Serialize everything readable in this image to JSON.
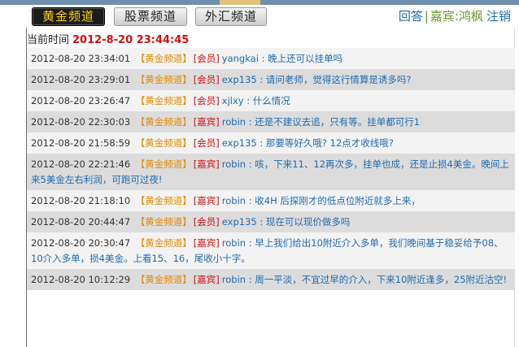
{
  "header": {
    "tabs": [
      {
        "label": "黄金频道",
        "active": true
      },
      {
        "label": "股票频道",
        "active": false
      },
      {
        "label": "外汇频道",
        "active": false
      }
    ],
    "reply_label": "回答",
    "separator": "|",
    "guest_label": "嘉宾:",
    "username": "鸿枫",
    "logout_label": "注销"
  },
  "current_time": {
    "label": "当前时间",
    "value": "2012-8-20 23:44:45"
  },
  "messages": [
    {
      "time": "2012-08-20 23:34:01",
      "channel": "【黄金频道】",
      "role": "[会员]",
      "user": "yangkai",
      "text": " : 晚上还可以挂单吗"
    },
    {
      "time": "2012-08-20 23:29:01",
      "channel": "【黄金频道】",
      "role": "[会员]",
      "user": "exp135",
      "text": " : 请问老师，觉得这行情算是诱多吗?"
    },
    {
      "time": "2012-08-20 23:26:47",
      "channel": "【黄金频道】",
      "role": "[会员]",
      "user": "xjlxy",
      "text": " : 什么情况"
    },
    {
      "time": "2012-08-20 22:30:03",
      "channel": "【黄金频道】",
      "role": "[嘉宾]",
      "user": "robin",
      "text": " : 还是不建议去追，只有等。挂单都可行1"
    },
    {
      "time": "2012-08-20 21:58:59",
      "channel": "【黄金频道】",
      "role": "[会员]",
      "user": "exp135",
      "text": " : 那要等好久哦? 12点才收线哦?"
    },
    {
      "time": "2012-08-20 22:21:46",
      "channel": "【黄金频道】",
      "role": "[嘉宾]",
      "user": "robin",
      "text": " : 咳，下来11、12再次多，挂单也成，还是止损4美金。晚间上来5美金左右利润，可跑可过夜!"
    },
    {
      "time": "2012-08-20 21:18:10",
      "channel": "【黄金频道】",
      "role": "[嘉宾]",
      "user": "robin",
      "text": " : 收4H 后探刚才的低点位附近就多上来，"
    },
    {
      "time": "2012-08-20 20:44:47",
      "channel": "【黄金频道】",
      "role": "[会员]",
      "user": "exp135",
      "text": " : 现在可以现价做多吗"
    },
    {
      "time": "2012-08-20 20:30:47",
      "channel": "【黄金频道】",
      "role": "[嘉宾]",
      "user": "robin",
      "text": " : 早上我们给出10附近介入多单，我们晚间基于稳妥给予08、10介入多单，损4美金。上看15、16，尾收小十字。"
    },
    {
      "time": "2012-08-20 10:12:29",
      "channel": "【黄金频道】",
      "role": "[嘉宾]",
      "user": "robin",
      "text": " : 周一平淡，不宜过早的介入，下来10附近逢多，25附近沽空!"
    }
  ],
  "colors": {
    "active_tab_bg": "#1c1c1c",
    "active_tab_text": "#ffd200",
    "time_value": "#d01010",
    "channel": "#e08a00",
    "role": "#d01010",
    "user_and_message": "#1f6bb0",
    "row_odd": "#f3f3f3",
    "row_even": "#dcdcdc"
  }
}
